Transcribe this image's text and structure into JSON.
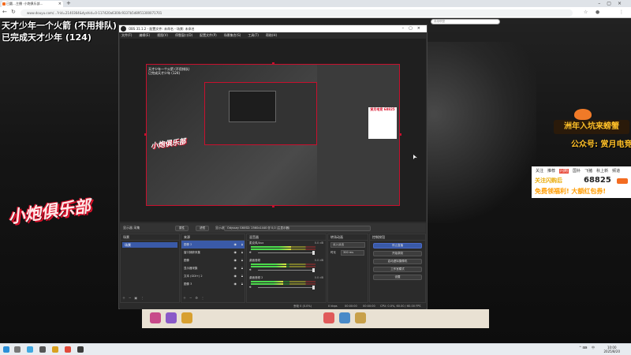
{
  "browser": {
    "tab_title": "已圆…主播 ·小炮俱乐部…",
    "url": "www.douyu.com/...?rid=2140364&dyshid=0-117420a6300c9337b5d8951300071701",
    "site_search_placeholder": "英雄联盟"
  },
  "stream": {
    "overlay_line1": "天才少年一个火箭 (不用排队)",
    "overlay_line2": "已完成天才少年 (124)",
    "logo_text": "小炮俱乐部",
    "poster": {
      "banner": "洲年入坑来螃蟹",
      "gongzhonghao": "公众号: 赏月电竞",
      "tabs": [
        "关注",
        "推荐",
        "闪购",
        "国补",
        "飞猪",
        "秋上新",
        "频道"
      ],
      "hot_tab_index": 2,
      "line1": "关注闪购后",
      "number": "68825",
      "line2": "免费领福利! 大额红包券!"
    }
  },
  "obs": {
    "title": "OBS 31.1.2 - 配置文件: 未命名 - 场景: 未命名",
    "menu": [
      "文件(F)",
      "编辑(E)",
      "视图(V)",
      "停靠窗口(D)",
      "配置文件(P)",
      "场景集合(S)",
      "工具(T)",
      "帮助(H)"
    ],
    "canvas_text": [
      "天才少年一个火箭 (不用排队)",
      "已完成天才少年 (124)"
    ],
    "canvas_logo": "小炮俱乐部",
    "canvas_poster": "赏月电竞 68825",
    "context": {
      "no_source": "显示器 采集",
      "properties_button": "属性",
      "filters_button": "滤镜",
      "display_label": "显示器",
      "display_value": "Odyssey G60SD: 2560x1440 @ 0,0 (主显示器)"
    },
    "scenes_title": "场景",
    "scenes": [
      "场景"
    ],
    "sources_title": "来源",
    "sources": [
      "图像 2",
      "窗口捕获采集",
      "图像",
      "显示器采集",
      "文本 (GDI+) 2",
      "图像 3"
    ],
    "mixer_title": "混音器",
    "mixer": [
      {
        "name": "麦克风/Aux",
        "db": "0.0 dB",
        "level": 0.62
      },
      {
        "name": "桌面音频",
        "db": "0.0 dB",
        "level": 0.55
      },
      {
        "name": "桌面音频 2",
        "db": "0.0 dB",
        "level": 0.5
      }
    ],
    "transitions_title": "转场动画",
    "transition_type": "淡入淡出",
    "duration_label": "时长",
    "duration_value": "300 ms",
    "controls_title": "控制按钮",
    "controls": [
      "停止直播",
      "开始录制",
      "启动虚拟摄像机",
      "工作室模式",
      "设置"
    ],
    "status": {
      "dropped": "丢帧 0 (0.0%)",
      "bitrate": "0 kbps",
      "live_time": "00:00:00",
      "rec_time": "00:00:00",
      "cpu_fps": "CPU: 0.0%, 60.00 / 60.00 FPS"
    }
  },
  "taskbar": {
    "clock_time": "10:00",
    "clock_date": "2025/8/20",
    "lang": "中"
  }
}
